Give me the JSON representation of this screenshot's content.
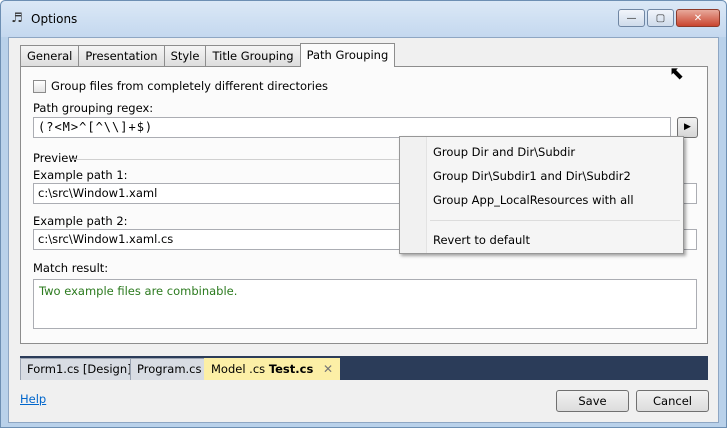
{
  "window": {
    "title": "Options",
    "icon": "music-note-icon",
    "minimize": "—",
    "maximize": "▢",
    "close": "✕"
  },
  "tabs": [
    "General",
    "Presentation",
    "Style",
    "Title Grouping",
    "Path Grouping"
  ],
  "active_tab": "Path Grouping",
  "group_dirs": {
    "label": "Group files from completely different directories",
    "checked": false
  },
  "regex": {
    "label": "Path grouping regex:",
    "value": "(?<M>^[^\\\\]+$)",
    "run_icon": "▶"
  },
  "preview": {
    "label": "Preview"
  },
  "example1": {
    "label": "Example path 1:",
    "value": "c:\\src\\Window1.xaml"
  },
  "example2": {
    "label": "Example path 2:",
    "value": "c:\\src\\Window1.xaml.cs"
  },
  "match": {
    "label": "Match result:",
    "value": "Two example files are combinable."
  },
  "menu": {
    "items": [
      "Group Dir and Dir\\Subdir",
      "Group Dir\\Subdir1 and Dir\\Subdir2",
      "Group App_LocalResources with all"
    ],
    "revert": "Revert to default"
  },
  "doc_tabs": {
    "form": "Form1.cs [Design]",
    "program": "Program.cs",
    "model": "Model .cs",
    "test": "Test.cs",
    "close_icon": "✕"
  },
  "footer": {
    "help": "Help",
    "save": "Save",
    "cancel": "Cancel"
  },
  "colors": {
    "accent_link": "#0066cc",
    "match_text": "#2b7a1e",
    "doc_tab_bar": "#2b3c59",
    "active_doc_tab": "#fcefa6"
  }
}
